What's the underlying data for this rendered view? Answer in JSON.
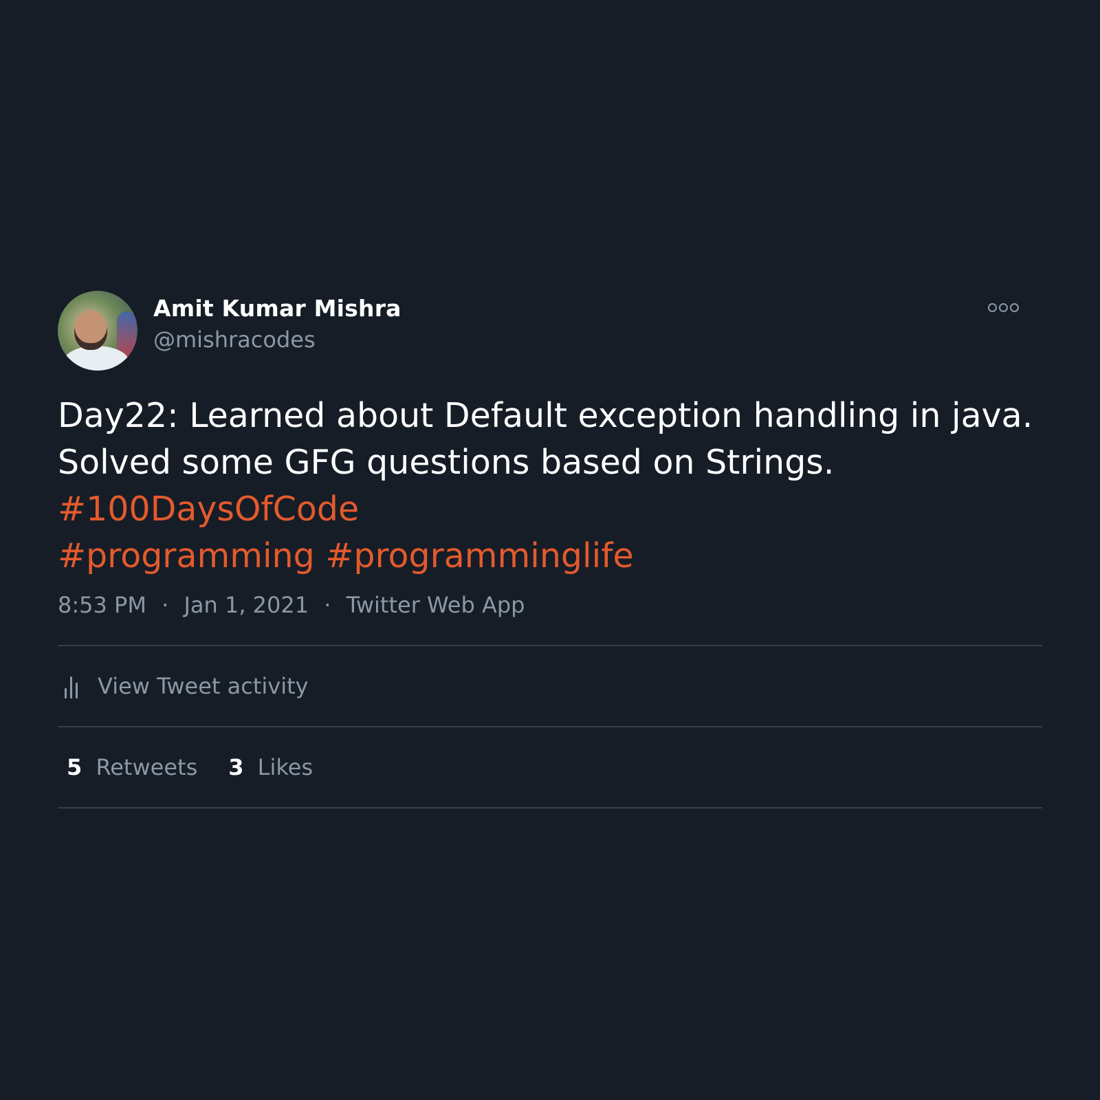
{
  "user": {
    "name": "Amit Kumar Mishra",
    "handle": "@mishracodes"
  },
  "tweet": {
    "lines": [
      "Day22: Learned about Default exception handling in java.",
      "Solved some GFG questions based on Strings."
    ],
    "hashtags": [
      "#100DaysOfCode",
      "#programming",
      "#programminglife"
    ]
  },
  "meta": {
    "time": "8:53 PM",
    "date": "Jan 1, 2021",
    "source": "Twitter Web App",
    "separator": "·"
  },
  "activity": {
    "label": "View Tweet activity"
  },
  "stats": {
    "retweets_count": "5",
    "retweets_label": "Retweets",
    "likes_count": "3",
    "likes_label": "Likes"
  },
  "icons": {
    "avatar": "avatar-image",
    "more": "more-options-icon",
    "activity": "bar-chart-icon"
  },
  "colors": {
    "background": "#161d27",
    "text": "#ffffff",
    "muted": "#8b98a5",
    "hashtag": "#e45a2d",
    "divider": "#38444d"
  }
}
